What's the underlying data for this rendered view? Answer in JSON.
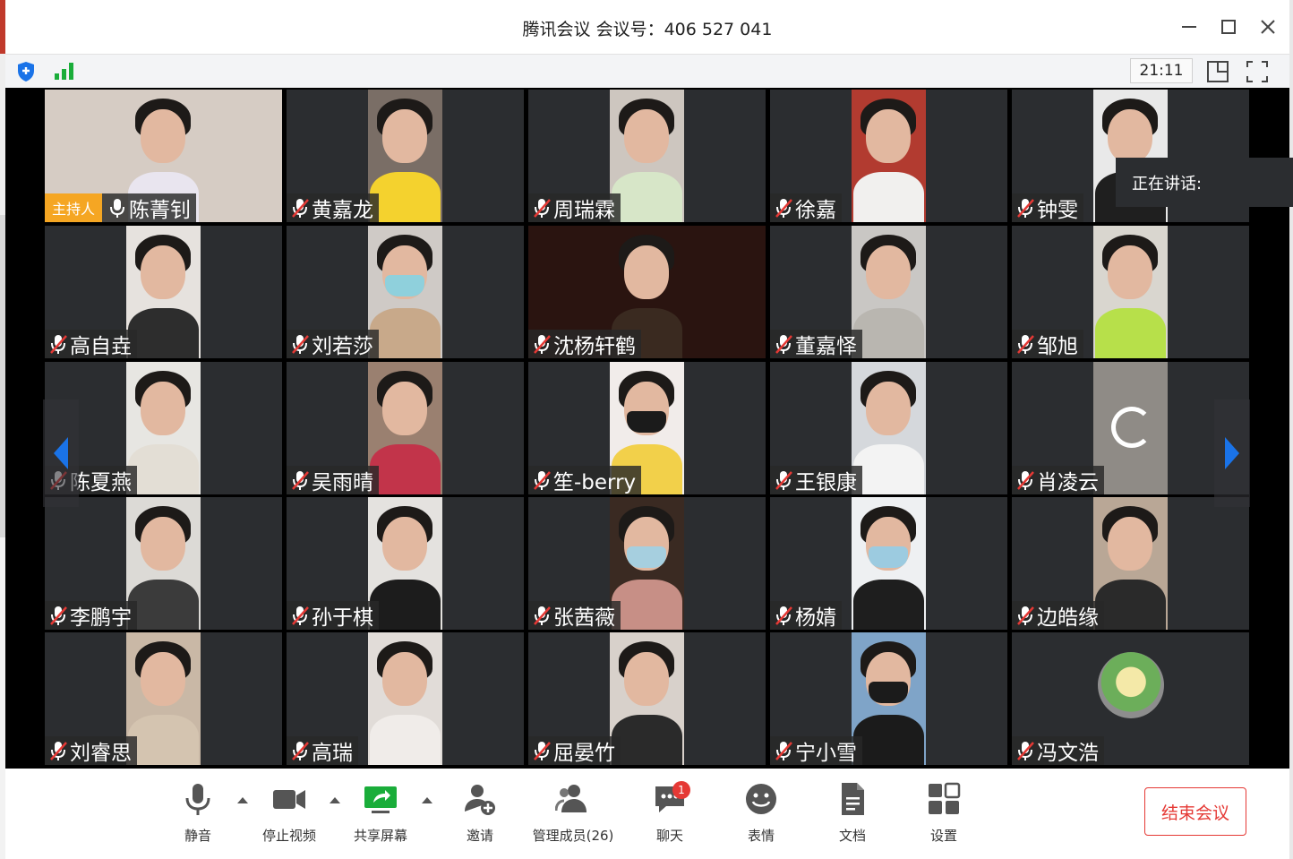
{
  "window": {
    "title": "腾讯会议 会议号：406 527 041",
    "minimize_icon": "minimize-icon",
    "maximize_icon": "maximize-icon",
    "close_icon": "close-icon"
  },
  "infobar": {
    "clock": "21:11",
    "security_icon": "shield-icon",
    "signal_icon": "signal-bars-icon",
    "layout_icon": "layout-icon",
    "fullscreen_icon": "fullscreen-icon"
  },
  "host_badge": "主持人",
  "speaking_label": "正在讲话:",
  "participants": [
    {
      "name": "陈菁钊",
      "mic": "on",
      "host": true,
      "bg": "#d6ccc4",
      "shirt": "#e9e5ef"
    },
    {
      "name": "黄嘉龙",
      "mic": "muted",
      "bg": "#7a6e66",
      "shirt": "#f4d22e"
    },
    {
      "name": "周瑞霖",
      "mic": "muted",
      "bg": "#cdc6bf",
      "shirt": "#d7e6c8"
    },
    {
      "name": "徐嘉",
      "mic": "muted",
      "bg": "#b23b30",
      "shirt": "#f1f0ee"
    },
    {
      "name": "钟雯",
      "mic": "muted",
      "bg": "#e9e9e9",
      "shirt": "#1f1f1f"
    },
    {
      "name": "高自垚",
      "mic": "muted",
      "bg": "#e6e2de",
      "shirt": "#2d2d2d"
    },
    {
      "name": "刘若莎",
      "mic": "muted",
      "bg": "#cfcac6",
      "shirt": "#c8a98a",
      "mask": "#8fd0dc"
    },
    {
      "name": "沈杨轩鹤",
      "mic": "muted",
      "bg": "#2a1410",
      "shirt": "#3a2a20",
      "wide": true
    },
    {
      "name": "董嘉怿",
      "mic": "muted",
      "bg": "#c9c7c4",
      "shirt": "#b9b6b0"
    },
    {
      "name": "邹旭",
      "mic": "muted",
      "bg": "#d9d6cf",
      "shirt": "#b7e04a"
    },
    {
      "name": "陈夏燕",
      "mic": "muted",
      "bg": "#e7e6e2",
      "shirt": "#e3ded5"
    },
    {
      "name": "吴雨晴",
      "mic": "muted",
      "bg": "#9a8070",
      "shirt": "#c2344a"
    },
    {
      "name": "笙-berry",
      "mic": "muted",
      "bg": "#f1ecea",
      "shirt": "#f2d04a",
      "mask": "#1b1b1b"
    },
    {
      "name": "王银康",
      "mic": "muted",
      "bg": "#d5d8dc",
      "shirt": "#f3f3f3"
    },
    {
      "name": "肖凌云",
      "mic": "muted",
      "bg": "#8f8b86",
      "shirt": "#8f8b86",
      "loading": true
    },
    {
      "name": "李鹏宇",
      "mic": "muted",
      "bg": "#dcdad6",
      "shirt": "#3b3b3b"
    },
    {
      "name": "孙于棋",
      "mic": "muted",
      "bg": "#e4e2df",
      "shirt": "#1c1c1c"
    },
    {
      "name": "张茜薇",
      "mic": "muted",
      "bg": "#3a2a22",
      "shirt": "#c78f86",
      "mask": "#a6cfdf"
    },
    {
      "name": "杨婧",
      "mic": "muted",
      "bg": "#eef0f2",
      "shirt": "#1e1e1e",
      "mask": "#9ccbe0"
    },
    {
      "name": "边皓缘",
      "mic": "muted",
      "bg": "#b9a796",
      "shirt": "#2a2a2a"
    },
    {
      "name": "刘睿思",
      "mic": "muted",
      "bg": "#c9b8a6",
      "shirt": "#d4c4b0"
    },
    {
      "name": "高瑞",
      "mic": "muted",
      "bg": "#e1dcd8",
      "shirt": "#f0ece9"
    },
    {
      "name": "屈晏竹",
      "mic": "muted",
      "bg": "#d8d1cb",
      "shirt": "#2a2a2a"
    },
    {
      "name": "宁小雪",
      "mic": "muted",
      "bg": "#7fa4c8",
      "shirt": "#1b1b1b",
      "mask": "#1b1b1b"
    },
    {
      "name": "冯文浩",
      "mic": "muted",
      "avatar": true
    }
  ],
  "toolbar": {
    "mute": "静音",
    "stop_video": "停止视频",
    "share_screen": "共享屏幕",
    "invite": "邀请",
    "manage_members": "管理成员(26)",
    "chat": "聊天",
    "chat_badge": "1",
    "reactions": "表情",
    "docs": "文档",
    "settings": "设置",
    "end_meeting": "结束会议"
  },
  "colors": {
    "tile_bg": "#2b2d30",
    "host_badge": "#f5a623",
    "accent_blue": "#1a73e8",
    "share_green": "#1aad3a",
    "end_red": "#e53935"
  }
}
